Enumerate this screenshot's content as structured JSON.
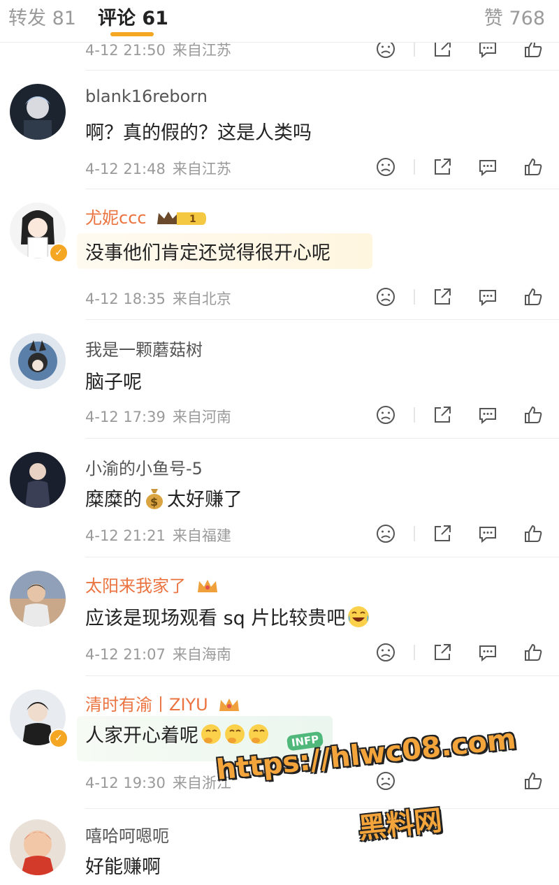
{
  "tabs": {
    "repost": "转发 81",
    "comments": "评论 61",
    "likes": "赞 768"
  },
  "partial_comment": {
    "time": "4-12 21:50",
    "location": "来自江苏"
  },
  "comments": [
    {
      "name": "blank16reborn",
      "text": "啊？真的假的？这是人类吗",
      "time": "4-12 21:48",
      "location": "来自江苏"
    },
    {
      "name": "尤妮ccc",
      "level": "1",
      "text": "没事他们肯定还觉得很开心呢",
      "time": "4-12 18:35",
      "location": "来自北京"
    },
    {
      "name": "我是一颗蘑菇树",
      "text": "脑子呢",
      "time": "4-12 17:39",
      "location": "来自河南"
    },
    {
      "name": "小渝的小鱼号-5",
      "text_before": "糜糜的",
      "text_after": "太好赚了",
      "time": "4-12 21:21",
      "location": "来自福建"
    },
    {
      "name": "太阳来我家了",
      "text": "应该是现场观看 sq 片比较贵吧",
      "time": "4-12 21:07",
      "location": "来自海南"
    },
    {
      "name": "清时有渝丨ZIYU",
      "text": "人家开心着呢",
      "sticker": "INFP",
      "time": "4-12 19:30",
      "location": "来自浙江"
    },
    {
      "name": "嘻哈呵嗯呃",
      "text": "好能赚啊"
    }
  ],
  "watermark": {
    "url": "https://hlwc08.com",
    "site": "黑料网"
  },
  "colors": {
    "accent": "#f5a623",
    "vip_name": "#eb7340",
    "meta": "#9a9a9a"
  },
  "icons": [
    "dislike-icon",
    "share-icon",
    "reply-icon",
    "like-icon",
    "money-bag-emoji",
    "laugh-cry-emoji",
    "think-emoji",
    "crown-icon"
  ]
}
